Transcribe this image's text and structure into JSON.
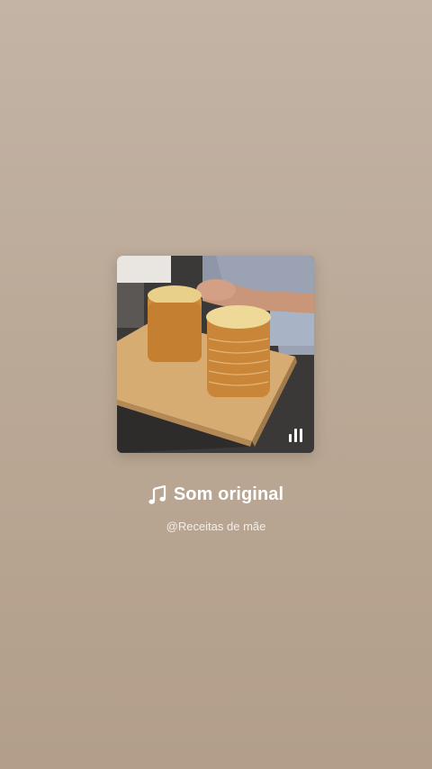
{
  "audio": {
    "title": "Som original",
    "author": "@Receitas de mãe"
  },
  "icons": {
    "music": "music-note-icon",
    "playing": "equalizer-icon"
  },
  "colors": {
    "background_top": "#c3b4a6",
    "background_bottom": "#b29e89",
    "text": "#ffffff"
  }
}
